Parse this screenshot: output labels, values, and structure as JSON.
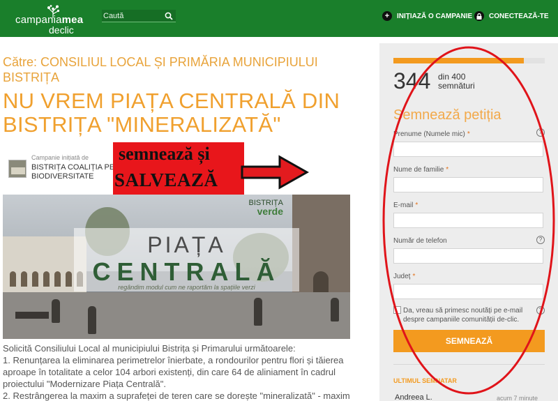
{
  "header": {
    "logo": {
      "line1_a": "campania",
      "line1_b": "mea",
      "line2": "declic"
    },
    "search": {
      "placeholder": "Caută"
    },
    "start_campaign": "INIȚIAZĂ O CAMPANIE",
    "login": "CONECTEAZĂ-TE",
    "colors": {
      "bar": "#1a7f2b"
    }
  },
  "petition": {
    "to": "Către: CONSILIUL LOCAL ȘI PRIMĂRIA MUNICIPIULUI BISTRIȚA",
    "title": "NU VREM PIAȚA CENTRALĂ DIN BISTRIȚA \"MINERALIZATĂ\"",
    "initiated_caption": "Campanie inițiată de",
    "initiator": "BISTRIȚA COALIȚIA PE BIODIVERSITATE",
    "overlay": {
      "line1": "semnează și",
      "line2": "SALVEAZĂ"
    },
    "image": {
      "brand_top": "BISTRIȚA",
      "brand_bottom": "verde",
      "title": "PIAȚA",
      "subtitle": "CENTRALĂ",
      "tagline": "regândim modul cum ne raportăm la spațiile verzi"
    },
    "body": [
      "Solicită Consiliului Local al municipiului Bistrița și Primarului următoarele:",
      "1. Renunțarea la eliminarea perimetrelor înierbate, a rondourilor pentru flori și tăierea",
      "aproape în totalitate a celor 104 arbori existenți, din care 64 de aliniament în cadrul",
      "proiectului \"Modernizare Piața Centrală\".",
      "2. Restrângerea la maxim a suprafeței de teren care se dorește \"mineralizată\" - maxim"
    ]
  },
  "sidebar": {
    "progress": {
      "current": 344,
      "goal": 400,
      "fraction": 0.86
    },
    "count": "344",
    "count_of": "din 400",
    "count_label": "semnături",
    "form_title": "Semnează petiția",
    "fields": [
      {
        "label": "Prenume (Numele mic)",
        "required": true,
        "help": true
      },
      {
        "label": "Nume de familie",
        "required": true,
        "help": false
      },
      {
        "label": "E-mail",
        "required": true,
        "help": false
      },
      {
        "label": "Număr de telefon",
        "required": false,
        "help": true
      },
      {
        "label": "Județ",
        "required": true,
        "help": false
      }
    ],
    "required_mark": "*",
    "help_mark": "?",
    "consent": "Da, vreau să primesc noutăți pe e-mail despre campaniile comunității de-clic.",
    "sign_button": "SEMNEAZĂ",
    "last_signer_title": "ULTIMUL SEMNATAR",
    "last_signer_name": "Andreea L.",
    "last_signer_time": "acum 7 minute",
    "colors": {
      "accent": "#f39a1f",
      "title": "#f2a94a"
    }
  }
}
